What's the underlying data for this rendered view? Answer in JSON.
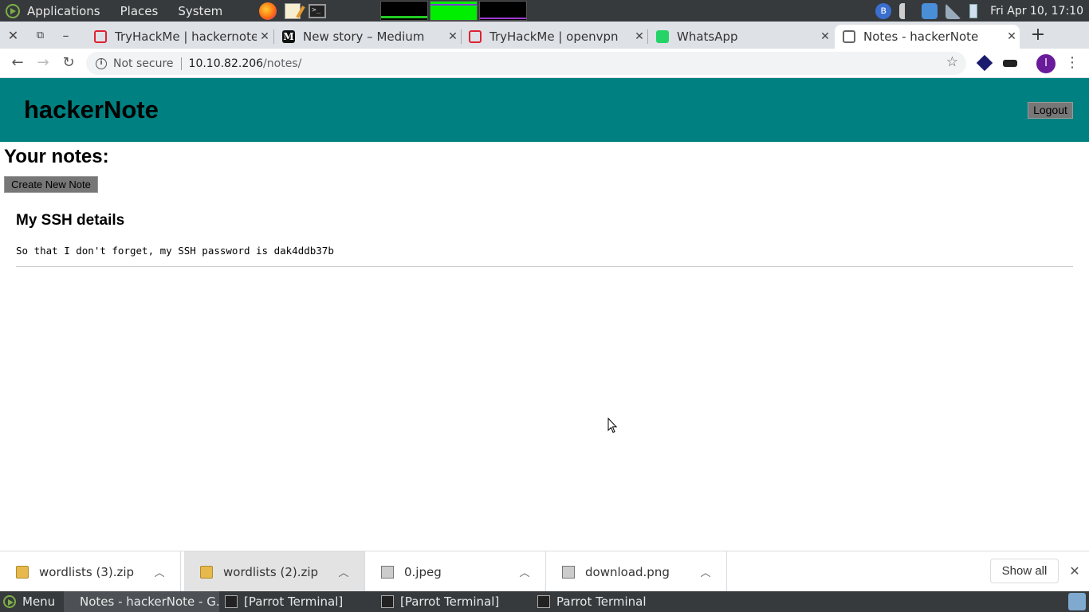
{
  "system_panel": {
    "menus": [
      "Applications",
      "Places",
      "System"
    ],
    "clock": "Fri Apr 10, 17:10"
  },
  "tabs": [
    {
      "title": "TryHackMe | hackernote",
      "icon": "tryhackme-icon"
    },
    {
      "title": "New story – Medium",
      "icon": "medium-icon"
    },
    {
      "title": "TryHackMe | openvpn",
      "icon": "tryhackme-icon"
    },
    {
      "title": "WhatsApp",
      "icon": "whatsapp-icon"
    },
    {
      "title": "Notes - hackerNote",
      "icon": "globe-icon",
      "active": true
    }
  ],
  "address_bar": {
    "security": "Not secure",
    "host": "10.10.82.206",
    "path": "/notes/"
  },
  "page": {
    "site_title": "hackerNote",
    "logout_label": "Logout",
    "heading": "Your notes:",
    "create_label": "Create New Note",
    "notes": [
      {
        "title": "My SSH details",
        "body": "So that I don't forget, my SSH password is dak4ddb37b"
      }
    ]
  },
  "downloads": {
    "items": [
      {
        "name": "wordlists (3).zip",
        "icon": "zip-icon"
      },
      {
        "name": "wordlists (2).zip",
        "icon": "zip-icon"
      },
      {
        "name": "0.jpeg",
        "icon": "image-icon"
      },
      {
        "name": "download.png",
        "icon": "image-icon"
      }
    ],
    "show_all": "Show all"
  },
  "taskbar": {
    "menu_label": "Menu",
    "tasks": [
      {
        "label": "Notes - hackerNote - G...",
        "icon": "chrome-icon",
        "active": true
      },
      {
        "label": "[Parrot Terminal]",
        "icon": "terminal-icon"
      },
      {
        "label": "[Parrot Terminal]",
        "icon": "terminal-icon"
      },
      {
        "label": "Parrot Terminal",
        "icon": "terminal-icon"
      }
    ]
  },
  "colors": {
    "header_teal": "#008080",
    "button_gray": "#777777",
    "panel_dark": "#363a3d"
  }
}
